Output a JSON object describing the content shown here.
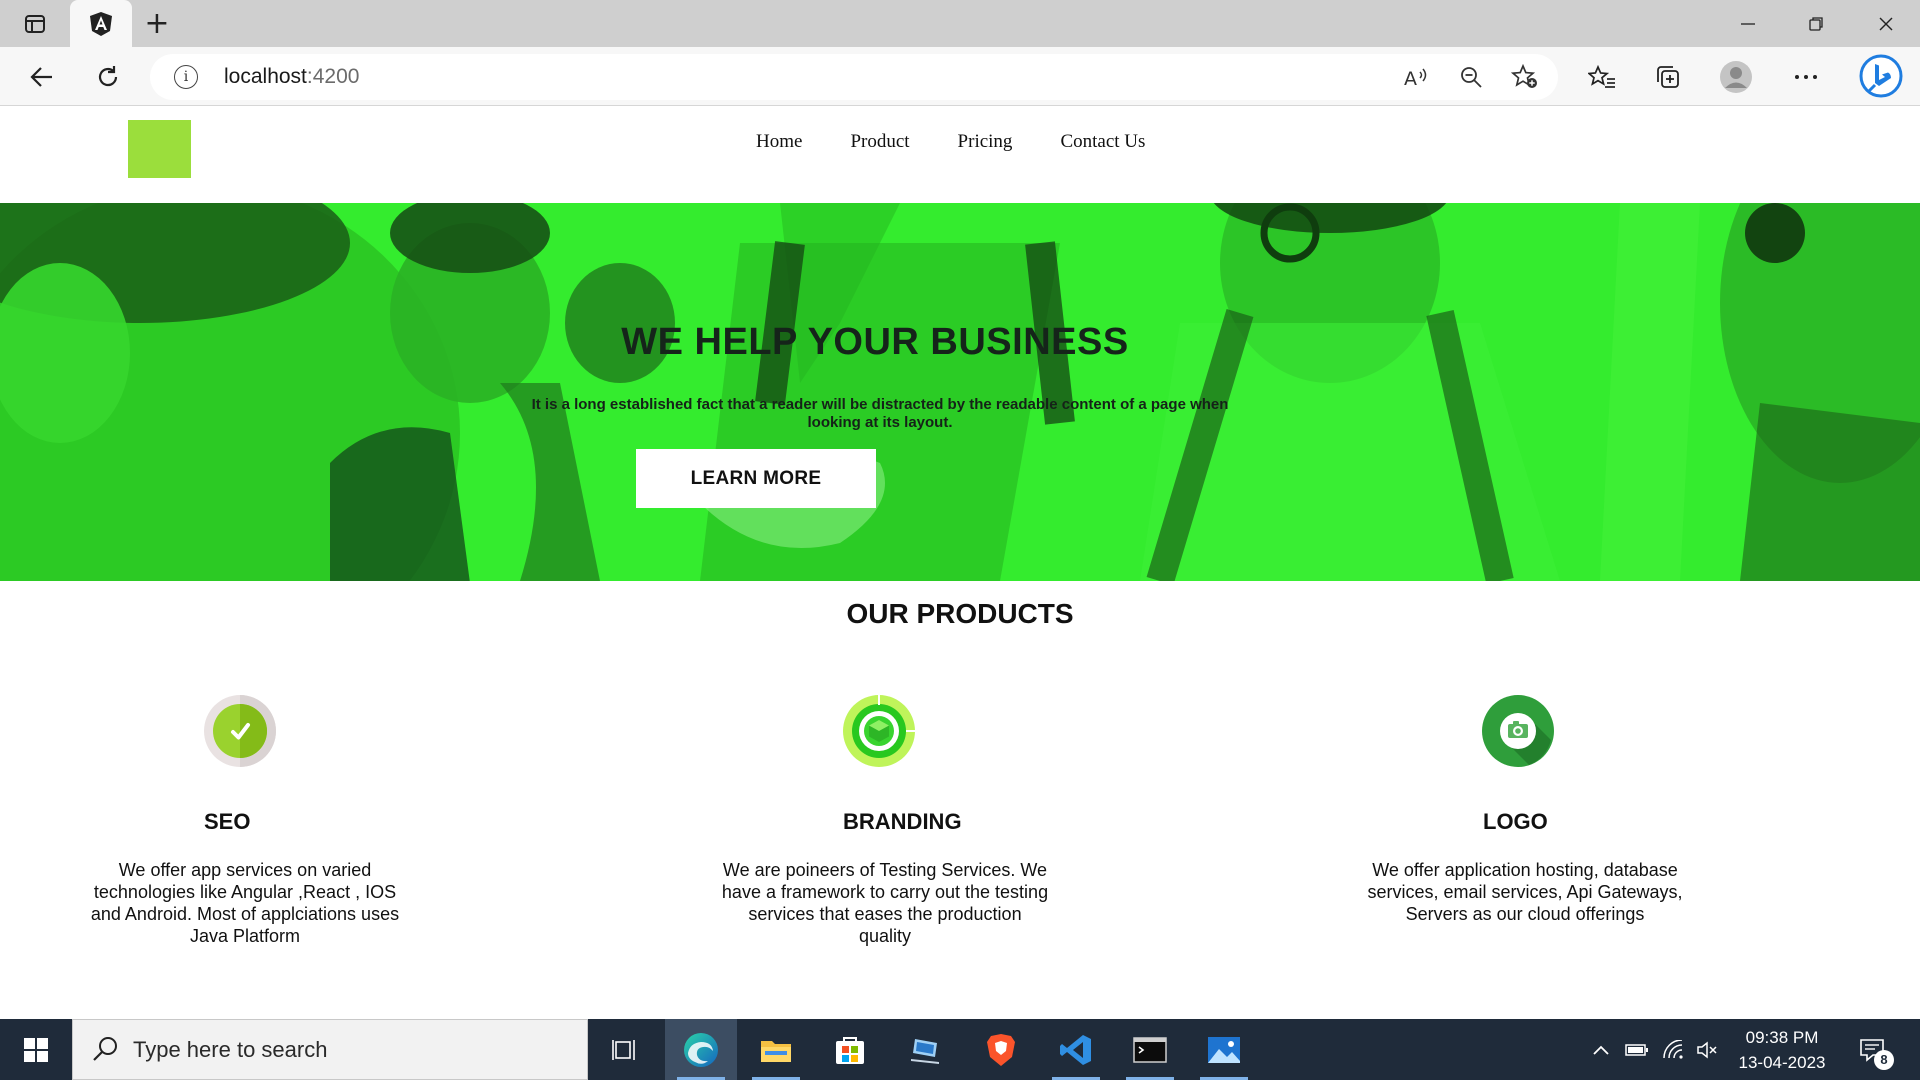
{
  "browser": {
    "tab": {
      "icon": "angular-icon"
    },
    "controls": {
      "minimize": "minimize-icon",
      "maximize": "restore-icon",
      "close": "close-icon"
    },
    "address": {
      "host": "localhost",
      "port": ":4200"
    },
    "toolbar": [
      "read-aloud-icon",
      "zoom-out-icon",
      "add-favorite-icon",
      "favorites-icon",
      "collections-icon",
      "profile-icon",
      "more-icon",
      "bing-icon"
    ]
  },
  "site": {
    "nav": [
      "Home",
      "Product",
      "Pricing",
      "Contact Us"
    ],
    "hero": {
      "title": "WE HELP YOUR BUSINESS",
      "text": "It is a long established fact that a reader will be distracted by the readable content of a page when looking at its layout.",
      "button": "LEARN MORE"
    },
    "products_title": "OUR PRODUCTS",
    "products": [
      {
        "name": "SEO",
        "icon": "check-badge-icon",
        "desc": "We offer app services on varied technologies like Angular ,React , IOS and Android. Most of applciations uses Java Platform"
      },
      {
        "name": "BRANDING",
        "icon": "target-cube-icon",
        "desc": "We are poineers of Testing Services. We have a framework to carry out the testing services that eases the production quality"
      },
      {
        "name": "LOGO",
        "icon": "camera-badge-icon",
        "desc": "We offer application hosting, database services, email services, Api Gateways, Servers as our cloud offerings"
      }
    ],
    "colors": {
      "hero_green": "#34ec2e",
      "logo_green": "#9bde3c"
    }
  },
  "taskbar": {
    "search_placeholder": "Type here to search",
    "apps": [
      "task-view-icon",
      "edge-icon",
      "file-explorer-icon",
      "store-icon",
      "remote-desktop-icon",
      "brave-icon",
      "vscode-icon",
      "terminal-icon",
      "photos-icon"
    ],
    "time": "09:38 PM",
    "date": "13-04-2023",
    "notifications": "8"
  }
}
